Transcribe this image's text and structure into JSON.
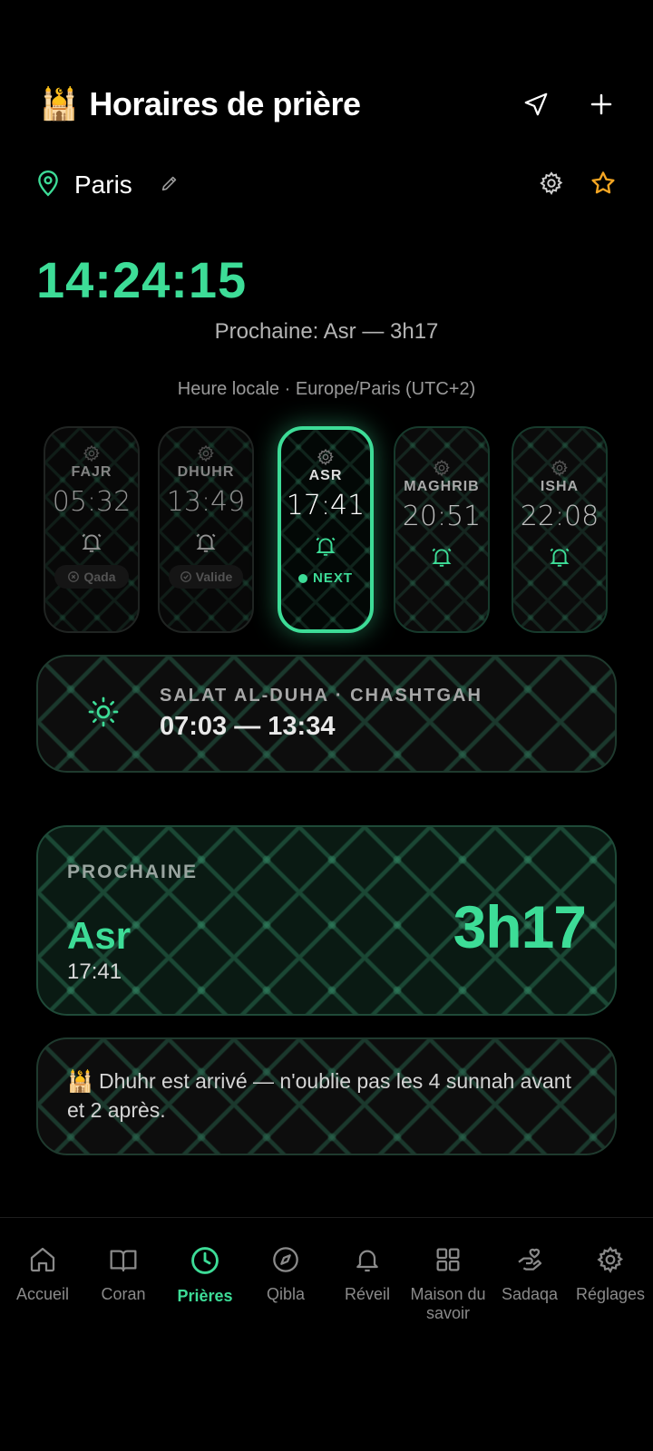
{
  "header": {
    "emoji": "🕌",
    "title": "Horaires de prière"
  },
  "location": {
    "city": "Paris"
  },
  "clock": {
    "time": "14:24:15"
  },
  "next_summary": "Prochaine: Asr — 3h17",
  "timezone": "Heure locale · Europe/Paris (UTC+2)",
  "prayers": [
    {
      "name": "FAJR",
      "time": "05:32",
      "status": "Qada"
    },
    {
      "name": "DHUHR",
      "time": "13:49",
      "status": "Valide"
    },
    {
      "name": "ASR",
      "time": "17:41",
      "status": "NEXT"
    },
    {
      "name": "MAGHRIB",
      "time": "20:51"
    },
    {
      "name": "ISHA",
      "time": "22:08"
    }
  ],
  "duha": {
    "label": "SALAT AL-DUHA · CHASHTGAH",
    "range": "07:03 — 13:34"
  },
  "next_card": {
    "label": "PROCHAINE",
    "prayer": "Asr",
    "time": "17:41",
    "countdown": "3h17"
  },
  "tip": {
    "text": "🕌 Dhuhr est arrivé — n'oublie pas les 4 sunnah avant et 2 après."
  },
  "nav": [
    {
      "label": "Accueil"
    },
    {
      "label": "Coran"
    },
    {
      "label": "Prières"
    },
    {
      "label": "Qibla"
    },
    {
      "label": "Réveil"
    },
    {
      "label": "Maison du savoir"
    },
    {
      "label": "Sadaqa"
    },
    {
      "label": "Réglages"
    }
  ],
  "colors": {
    "accent": "#3ddc97",
    "star": "#f5a623",
    "background": "#000000"
  },
  "icons": [
    "navigation-icon",
    "plus-icon",
    "map-pin-icon",
    "pencil-icon",
    "gear-icon",
    "star-icon",
    "bell-icon",
    "sun-icon",
    "home-icon",
    "book-icon",
    "clock-icon",
    "compass-icon",
    "grid-icon",
    "hand-heart-icon"
  ]
}
